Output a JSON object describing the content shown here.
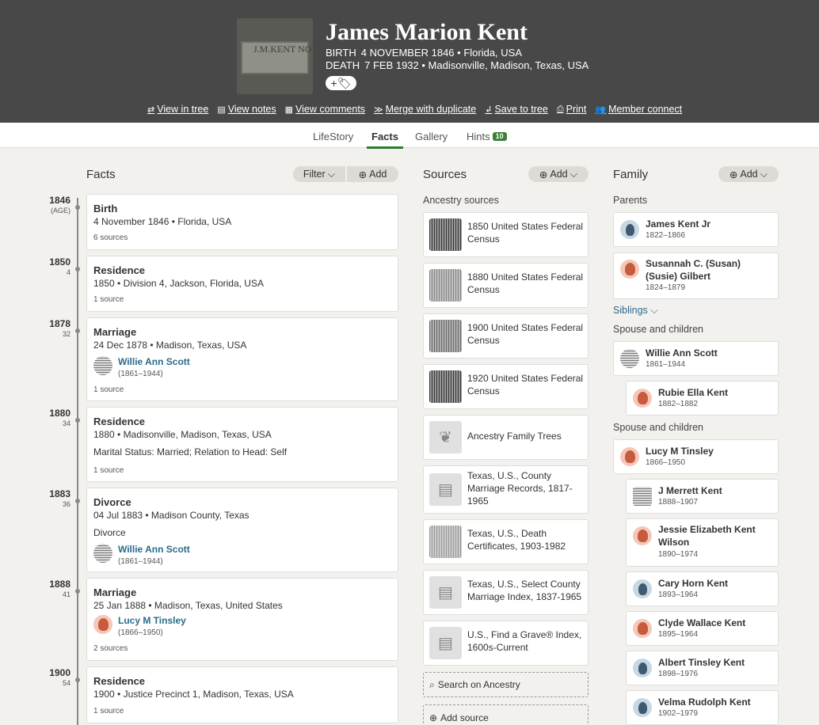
{
  "header": {
    "name": "James Marion Kent",
    "stone_text": "J.M.KENT NOV 4 FEB",
    "birth_label": "BIRTH",
    "birth_value": "4 NOVEMBER 1846 • Florida, USA",
    "death_label": "DEATH",
    "death_value": "7 FEB 1932 • Madisonville, Madison, Texas, USA",
    "pill": "+🏷",
    "actions": [
      "View in tree",
      "View notes",
      "View comments",
      "Merge with duplicate",
      "Save to tree",
      "Print",
      "Member connect"
    ],
    "action_icons": [
      "⇄",
      "▤",
      "▦",
      "≫",
      "↲",
      "⎙",
      "👥"
    ]
  },
  "tabs": [
    {
      "label": "LifeStory"
    },
    {
      "label": "Facts"
    },
    {
      "label": "Gallery"
    },
    {
      "label": "Hints",
      "badge": "10"
    }
  ],
  "facts": {
    "title": "Facts",
    "filter_label": "Filter",
    "add_label": "Add",
    "items": [
      {
        "year": "1846",
        "age": "(AGE)",
        "title": "Birth",
        "detail": "4 November 1846 • Florida, USA",
        "sources": "6 sources"
      },
      {
        "year": "1850",
        "age": "4",
        "title": "Residence",
        "detail": "1850 • Division 4, Jackson, Florida, USA",
        "sources": "1 source"
      },
      {
        "year": "1878",
        "age": "32",
        "title": "Marriage",
        "detail": "24 Dec 1878 • Madison, Texas, USA",
        "person": "Willie Ann Scott",
        "person_dates": "(1861–1944)",
        "sources": "1 source"
      },
      {
        "year": "1880",
        "age": "34",
        "title": "Residence",
        "detail": "1880 • Madisonville, Madison, Texas, USA",
        "extra": "Marital Status: Married; Relation to Head: Self",
        "sources": "1 source"
      },
      {
        "year": "1883",
        "age": "36",
        "title": "Divorce",
        "detail": "04 Jul 1883 • Madison County, Texas",
        "extra": "Divorce",
        "person": "Willie Ann Scott",
        "person_dates": "(1861–1944)"
      },
      {
        "year": "1888",
        "age": "41",
        "title": "Marriage",
        "detail": "25 Jan 1888 • Madison, Texas, United States",
        "person": "Lucy M Tinsley",
        "person_dates": "(1866–1950)",
        "sources": "2 sources"
      },
      {
        "year": "1900",
        "age": "54",
        "title": "Residence",
        "detail": "1900 • Justice Precinct 1, Madison, Texas, USA",
        "sources": "1 source"
      }
    ]
  },
  "sources": {
    "title": "Sources",
    "add_label": "Add",
    "subtitle": "Ancestry sources",
    "items": [
      "1850 United States Federal Census",
      "1880 United States Federal Census",
      "1900 United States Federal Census",
      "1920 United States Federal Census",
      "Ancestry Family Trees",
      "Texas, U.S., County Marriage Records, 1817-1965",
      "Texas, U.S., Death Certificates, 1903-1982",
      "Texas, U.S., Select County Marriage Index, 1837-1965",
      "U.S., Find a Grave® Index, 1600s-Current"
    ],
    "search_label": "Search on Ancestry",
    "add_source_label": "Add source"
  },
  "family": {
    "title": "Family",
    "add_label": "Add",
    "parents_label": "Parents",
    "siblings_label": "Siblings",
    "spouse_label_1": "Spouse and children",
    "spouse_label_2": "Spouse and children",
    "members": [
      {
        "name": "James Kent Jr",
        "dates": "1822–1866"
      },
      {
        "name": "Susannah C. (Susan) (Susie) Gilbert",
        "dates": "1824–1879"
      },
      {
        "name": "Willie Ann Scott",
        "dates": "1861–1944"
      },
      {
        "name": "Rubie Ella Kent",
        "dates": "1882–1882"
      },
      {
        "name": "Lucy M Tinsley",
        "dates": "1866–1950"
      },
      {
        "name": "J Merrett Kent",
        "dates": "1888–1907"
      },
      {
        "name": "Jessie Elizabeth Kent Wilson",
        "dates": "1890–1974"
      },
      {
        "name": "Cary Horn Kent",
        "dates": "1893–1964"
      },
      {
        "name": "Clyde Wallace Kent",
        "dates": "1895–1964"
      },
      {
        "name": "Albert Tinsley Kent",
        "dates": "1898–1976"
      },
      {
        "name": "Velma Rudolph Kent",
        "dates": "1902–1979"
      }
    ]
  }
}
